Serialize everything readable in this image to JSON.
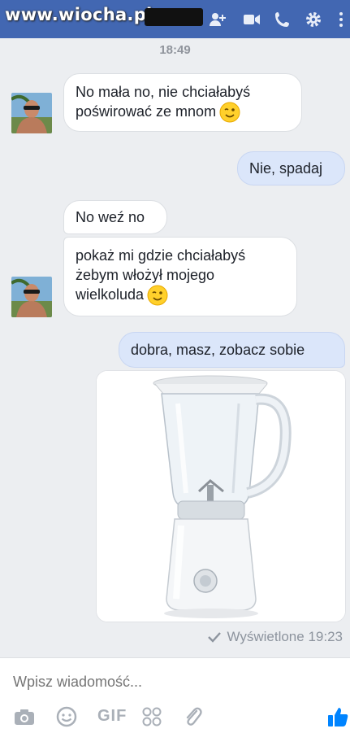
{
  "header": {
    "watermark": "www.wiocha.pl",
    "icons": [
      "add-person-icon",
      "video-camera-icon",
      "phone-icon",
      "gear-icon"
    ]
  },
  "chat": {
    "timestamp": "18:49",
    "messages": [
      {
        "direction": "in",
        "lines": [
          "No mała no, nie chciałabyś",
          "poświrować ze mnom"
        ],
        "emoji": "winking-face"
      },
      {
        "direction": "out",
        "text": "Nie, spadaj"
      },
      {
        "direction": "in",
        "text": "No weź no"
      },
      {
        "direction": "in",
        "lines": [
          "pokaż mi gdzie chciałabyś",
          "żebym włożył mojego",
          "wielkoluda"
        ],
        "emoji": "winking-face"
      },
      {
        "direction": "out",
        "text": "dobra, masz, zobacz sobie"
      },
      {
        "direction": "out",
        "attachment": "blender-photo"
      }
    ],
    "seen_label": "Wyświetlone 19:23"
  },
  "composer": {
    "placeholder": "Wpisz wiadomość...",
    "gif_label": "GIF",
    "icons": [
      "camera-icon",
      "smiley-icon",
      "gif-icon",
      "sticker-grid-icon",
      "paperclip-icon",
      "thumbs-up-icon"
    ]
  },
  "colors": {
    "header_bg": "#4267b2",
    "outgoing_bubble": "#dbe6fa",
    "incoming_bubble": "#ffffff",
    "like_blue": "#0084ff"
  }
}
